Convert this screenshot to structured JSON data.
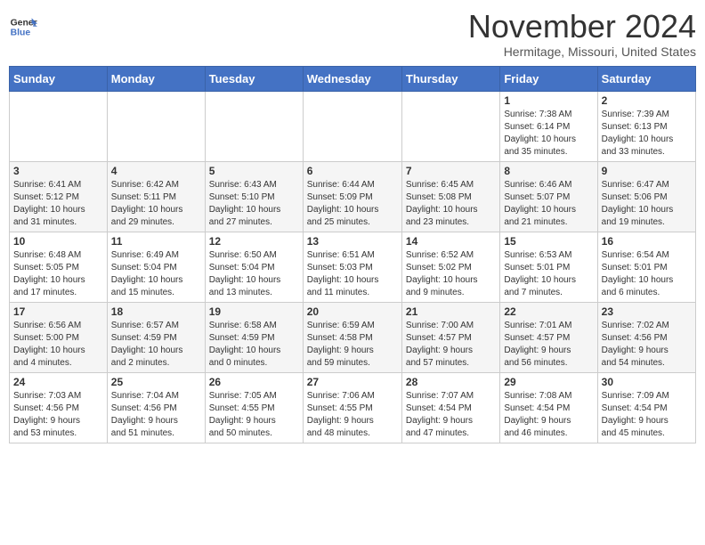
{
  "header": {
    "logo_line1": "General",
    "logo_line2": "Blue",
    "month": "November 2024",
    "location": "Hermitage, Missouri, United States"
  },
  "weekdays": [
    "Sunday",
    "Monday",
    "Tuesday",
    "Wednesday",
    "Thursday",
    "Friday",
    "Saturday"
  ],
  "weeks": [
    [
      {
        "day": "",
        "info": ""
      },
      {
        "day": "",
        "info": ""
      },
      {
        "day": "",
        "info": ""
      },
      {
        "day": "",
        "info": ""
      },
      {
        "day": "",
        "info": ""
      },
      {
        "day": "1",
        "info": "Sunrise: 7:38 AM\nSunset: 6:14 PM\nDaylight: 10 hours\nand 35 minutes."
      },
      {
        "day": "2",
        "info": "Sunrise: 7:39 AM\nSunset: 6:13 PM\nDaylight: 10 hours\nand 33 minutes."
      }
    ],
    [
      {
        "day": "3",
        "info": "Sunrise: 6:41 AM\nSunset: 5:12 PM\nDaylight: 10 hours\nand 31 minutes."
      },
      {
        "day": "4",
        "info": "Sunrise: 6:42 AM\nSunset: 5:11 PM\nDaylight: 10 hours\nand 29 minutes."
      },
      {
        "day": "5",
        "info": "Sunrise: 6:43 AM\nSunset: 5:10 PM\nDaylight: 10 hours\nand 27 minutes."
      },
      {
        "day": "6",
        "info": "Sunrise: 6:44 AM\nSunset: 5:09 PM\nDaylight: 10 hours\nand 25 minutes."
      },
      {
        "day": "7",
        "info": "Sunrise: 6:45 AM\nSunset: 5:08 PM\nDaylight: 10 hours\nand 23 minutes."
      },
      {
        "day": "8",
        "info": "Sunrise: 6:46 AM\nSunset: 5:07 PM\nDaylight: 10 hours\nand 21 minutes."
      },
      {
        "day": "9",
        "info": "Sunrise: 6:47 AM\nSunset: 5:06 PM\nDaylight: 10 hours\nand 19 minutes."
      }
    ],
    [
      {
        "day": "10",
        "info": "Sunrise: 6:48 AM\nSunset: 5:05 PM\nDaylight: 10 hours\nand 17 minutes."
      },
      {
        "day": "11",
        "info": "Sunrise: 6:49 AM\nSunset: 5:04 PM\nDaylight: 10 hours\nand 15 minutes."
      },
      {
        "day": "12",
        "info": "Sunrise: 6:50 AM\nSunset: 5:04 PM\nDaylight: 10 hours\nand 13 minutes."
      },
      {
        "day": "13",
        "info": "Sunrise: 6:51 AM\nSunset: 5:03 PM\nDaylight: 10 hours\nand 11 minutes."
      },
      {
        "day": "14",
        "info": "Sunrise: 6:52 AM\nSunset: 5:02 PM\nDaylight: 10 hours\nand 9 minutes."
      },
      {
        "day": "15",
        "info": "Sunrise: 6:53 AM\nSunset: 5:01 PM\nDaylight: 10 hours\nand 7 minutes."
      },
      {
        "day": "16",
        "info": "Sunrise: 6:54 AM\nSunset: 5:01 PM\nDaylight: 10 hours\nand 6 minutes."
      }
    ],
    [
      {
        "day": "17",
        "info": "Sunrise: 6:56 AM\nSunset: 5:00 PM\nDaylight: 10 hours\nand 4 minutes."
      },
      {
        "day": "18",
        "info": "Sunrise: 6:57 AM\nSunset: 4:59 PM\nDaylight: 10 hours\nand 2 minutes."
      },
      {
        "day": "19",
        "info": "Sunrise: 6:58 AM\nSunset: 4:59 PM\nDaylight: 10 hours\nand 0 minutes."
      },
      {
        "day": "20",
        "info": "Sunrise: 6:59 AM\nSunset: 4:58 PM\nDaylight: 9 hours\nand 59 minutes."
      },
      {
        "day": "21",
        "info": "Sunrise: 7:00 AM\nSunset: 4:57 PM\nDaylight: 9 hours\nand 57 minutes."
      },
      {
        "day": "22",
        "info": "Sunrise: 7:01 AM\nSunset: 4:57 PM\nDaylight: 9 hours\nand 56 minutes."
      },
      {
        "day": "23",
        "info": "Sunrise: 7:02 AM\nSunset: 4:56 PM\nDaylight: 9 hours\nand 54 minutes."
      }
    ],
    [
      {
        "day": "24",
        "info": "Sunrise: 7:03 AM\nSunset: 4:56 PM\nDaylight: 9 hours\nand 53 minutes."
      },
      {
        "day": "25",
        "info": "Sunrise: 7:04 AM\nSunset: 4:56 PM\nDaylight: 9 hours\nand 51 minutes."
      },
      {
        "day": "26",
        "info": "Sunrise: 7:05 AM\nSunset: 4:55 PM\nDaylight: 9 hours\nand 50 minutes."
      },
      {
        "day": "27",
        "info": "Sunrise: 7:06 AM\nSunset: 4:55 PM\nDaylight: 9 hours\nand 48 minutes."
      },
      {
        "day": "28",
        "info": "Sunrise: 7:07 AM\nSunset: 4:54 PM\nDaylight: 9 hours\nand 47 minutes."
      },
      {
        "day": "29",
        "info": "Sunrise: 7:08 AM\nSunset: 4:54 PM\nDaylight: 9 hours\nand 46 minutes."
      },
      {
        "day": "30",
        "info": "Sunrise: 7:09 AM\nSunset: 4:54 PM\nDaylight: 9 hours\nand 45 minutes."
      }
    ]
  ]
}
